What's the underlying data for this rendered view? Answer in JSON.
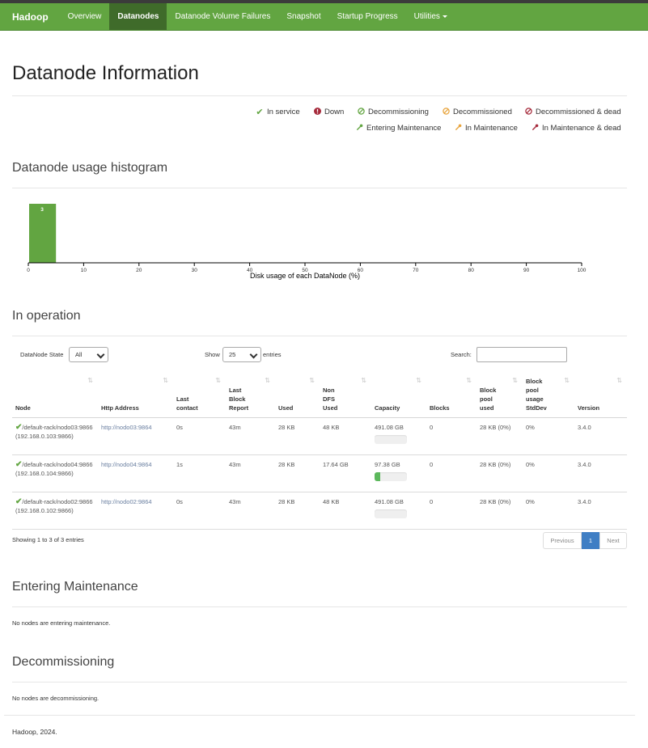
{
  "navbar": {
    "brand": "Hadoop",
    "items": [
      {
        "label": "Overview"
      },
      {
        "label": "Datanodes"
      },
      {
        "label": "Datanode Volume Failures"
      },
      {
        "label": "Snapshot"
      },
      {
        "label": "Startup Progress"
      },
      {
        "label": "Utilities"
      }
    ],
    "active": "Datanodes",
    "color": "#62a541"
  },
  "page_title": "Datanode Information",
  "legend": [
    {
      "label": "In service",
      "icon": "check-icon",
      "color": "#62a541"
    },
    {
      "label": "Down",
      "icon": "exclamation-circle-icon",
      "color": "#a62b3c"
    },
    {
      "label": "Decommissioning",
      "icon": "ban-icon",
      "color": "#62a541"
    },
    {
      "label": "Decommissioned",
      "icon": "ban-icon",
      "color": "#e8a43c"
    },
    {
      "label": "Decommissioned & dead",
      "icon": "ban-icon",
      "color": "#a62b3c"
    },
    {
      "label": "Entering Maintenance",
      "icon": "wrench-icon",
      "color": "#62a541"
    },
    {
      "label": "In Maintenance",
      "icon": "wrench-icon",
      "color": "#e8a43c"
    },
    {
      "label": "In Maintenance & dead",
      "icon": "wrench-icon",
      "color": "#a62b3c"
    }
  ],
  "histogram": {
    "heading": "Datanode usage histogram",
    "chart_data": {
      "type": "bar",
      "bins": [
        [
          0,
          5
        ]
      ],
      "values": [
        3
      ],
      "xlabel": "Disk usage of each DataNode (%)",
      "xlim": [
        0,
        100
      ],
      "x_ticks": [
        "0",
        "10",
        "20",
        "30",
        "40",
        "50",
        "60",
        "70",
        "80",
        "90",
        "100"
      ],
      "bar_color": "#62a541"
    }
  },
  "in_operation": {
    "heading": "In operation",
    "state_label": "DataNode State",
    "state_value": "All",
    "show_label": "Show",
    "show_value": "25",
    "entries_label": "entries",
    "search_label": "Search:",
    "columns": [
      "Node",
      "Http Address",
      "Last contact",
      "Last Block Report",
      "Used",
      "Non DFS Used",
      "Capacity",
      "Blocks",
      "Block pool used",
      "Block pool usage StdDev",
      "Version"
    ],
    "rows": [
      {
        "node": "/default-rack/nodo03:9866 (192.168.0.103:9866)",
        "http": "http://nodo03:9864",
        "contact": "0s",
        "report": "43m",
        "used": "28 KB",
        "nondfs": "48 KB",
        "capacity": "491.08 GB",
        "capacity_pct": 0,
        "blocks": "0",
        "bpused": "28 KB (0%)",
        "stddev": "0%",
        "version": "3.4.0"
      },
      {
        "node": "/default-rack/nodo04:9866 (192.168.0.104:9866)",
        "http": "http://nodo04:9864",
        "contact": "1s",
        "report": "43m",
        "used": "28 KB",
        "nondfs": "17.64 GB",
        "capacity": "97.38 GB",
        "capacity_pct": 18,
        "blocks": "0",
        "bpused": "28 KB (0%)",
        "stddev": "0%",
        "version": "3.4.0"
      },
      {
        "node": "/default-rack/nodo02:9866 (192.168.0.102:9866)",
        "http": "http://nodo02:9864",
        "contact": "0s",
        "report": "43m",
        "used": "28 KB",
        "nondfs": "48 KB",
        "capacity": "491.08 GB",
        "capacity_pct": 0,
        "blocks": "0",
        "bpused": "28 KB (0%)",
        "stddev": "0%",
        "version": "3.4.0"
      }
    ],
    "showing": "Showing 1 to 3 of 3 entries",
    "pager": {
      "prev": "Previous",
      "current": "1",
      "next": "Next"
    }
  },
  "entering_maintenance": {
    "heading": "Entering Maintenance",
    "message": "No nodes are entering maintenance."
  },
  "decommissioning": {
    "heading": "Decommissioning",
    "message": "No nodes are decommissioning."
  },
  "footer": "Hadoop, 2024."
}
